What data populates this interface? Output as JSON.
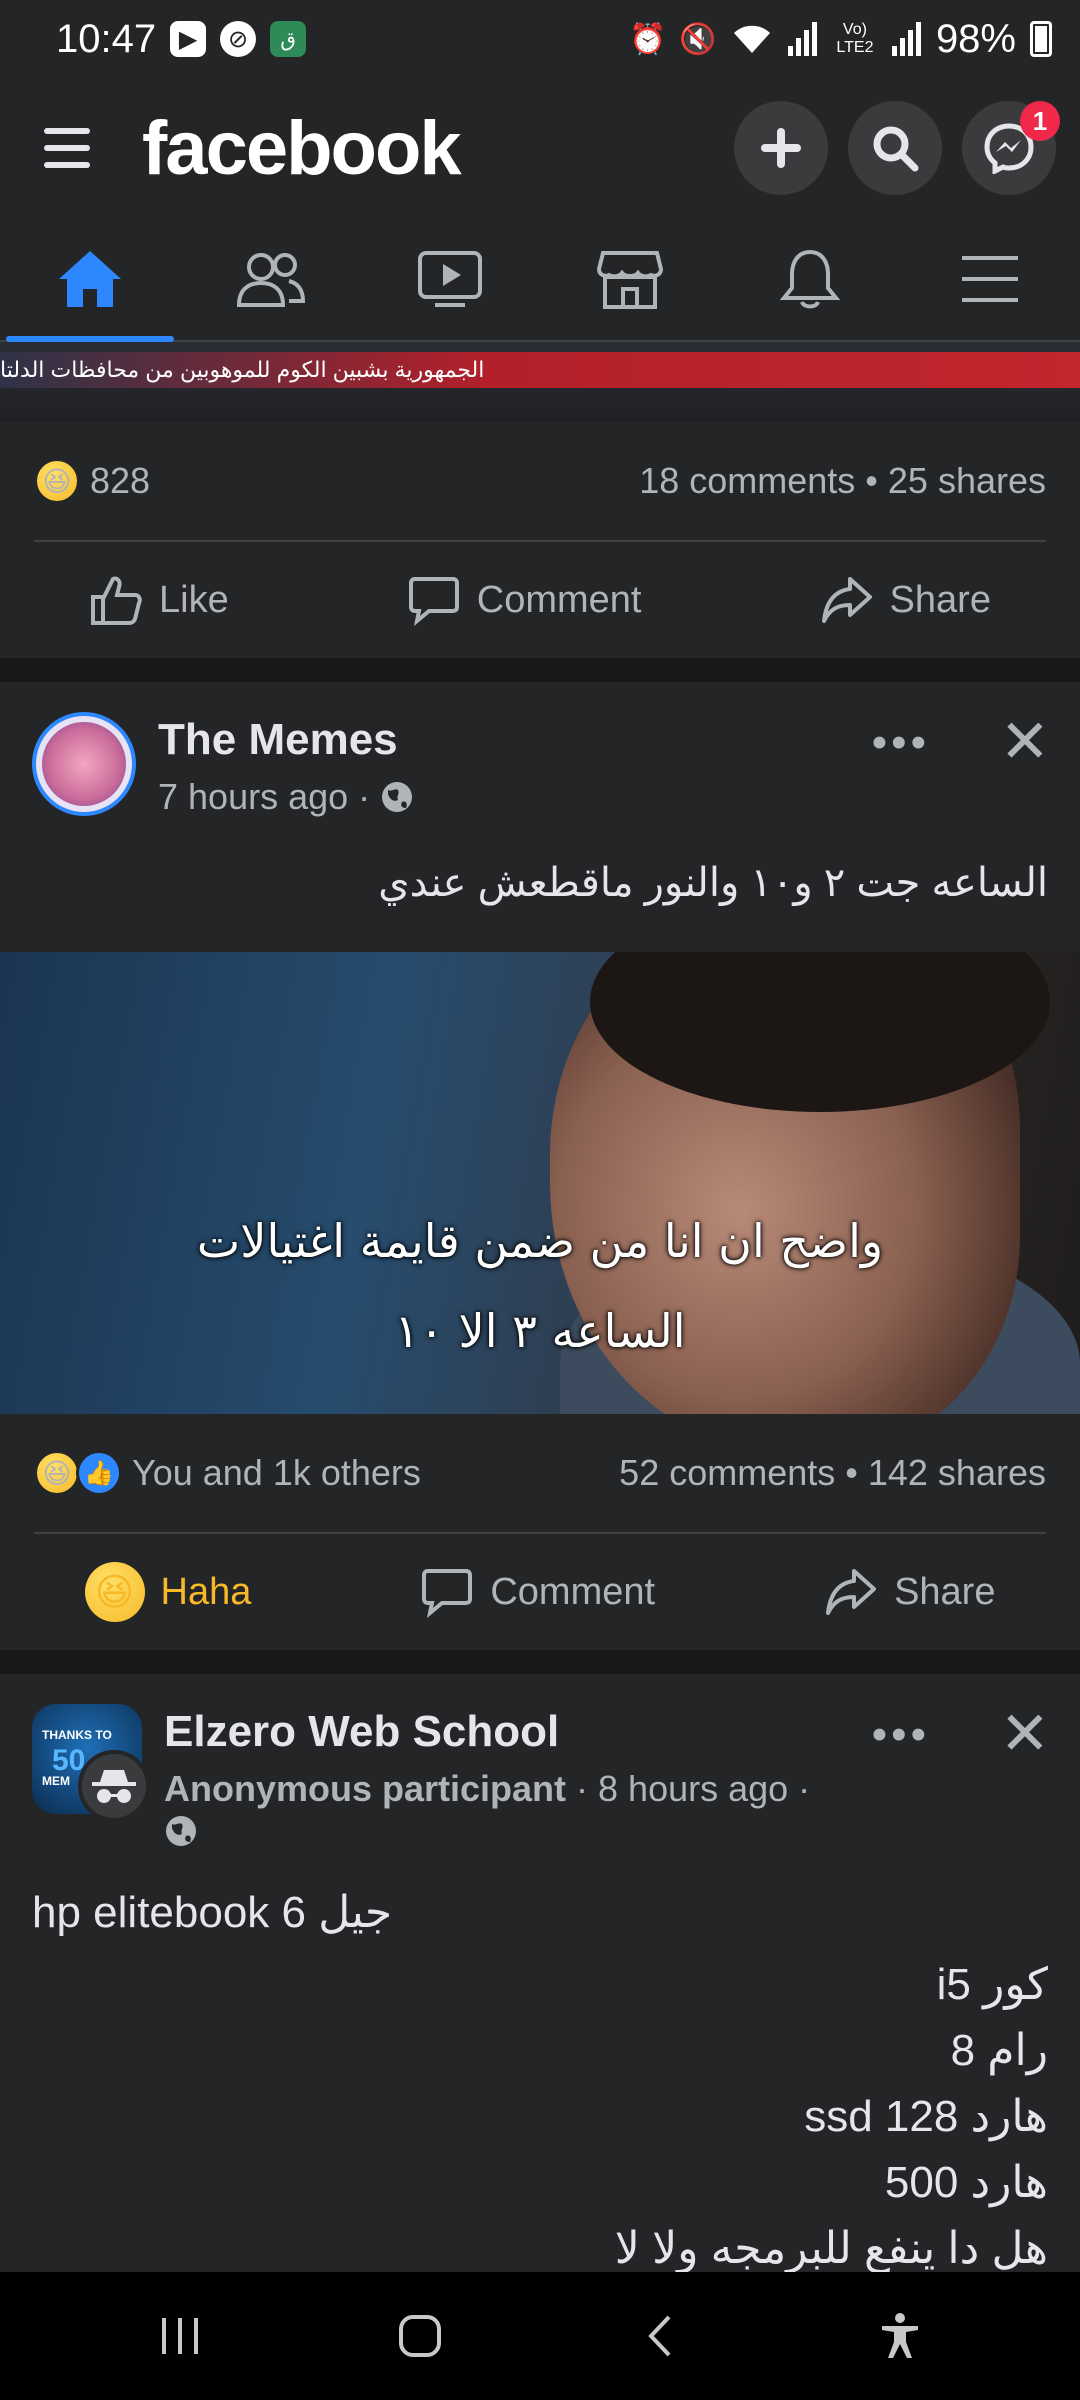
{
  "status_bar": {
    "time": "10:47",
    "network": "Vo) LTE2",
    "battery": "98%"
  },
  "header": {
    "logo": "facebook",
    "messenger_badge": "1",
    "colors": {
      "accent": "#2d88ff",
      "badge": "#f02849",
      "background": "#242526"
    }
  },
  "tabs": [
    {
      "name": "home",
      "icon": "home-icon",
      "active": true
    },
    {
      "name": "friends",
      "icon": "friends-icon",
      "active": false
    },
    {
      "name": "watch",
      "icon": "video-icon",
      "active": false
    },
    {
      "name": "marketplace",
      "icon": "store-icon",
      "active": false
    },
    {
      "name": "notifications",
      "icon": "bell-icon",
      "active": false
    },
    {
      "name": "menu",
      "icon": "menu-icon",
      "active": false
    }
  ],
  "post1": {
    "ticker_text": "الجمهورية بشبين الكوم للموهوبين من محافظات الدلتا",
    "reaction_count": "828",
    "comments_shares": "18 comments • 25 shares",
    "actions": {
      "like": "Like",
      "comment": "Comment",
      "share": "Share"
    }
  },
  "post2": {
    "author": "The Memes",
    "time": "7 hours ago ·",
    "text": "الساعه جت ٢ و١٠ والنور ماقطعش عندي",
    "caption_line1": "واضح ان انا من ضمن قايمة اغتيالات",
    "caption_line2": "الساعه ٣ الا ١٠",
    "reactions_summary": "You and 1k others",
    "comments_shares": "52 comments • 142 shares",
    "actions": {
      "reacted": "Haha",
      "comment": "Comment",
      "share": "Share"
    }
  },
  "post3": {
    "author": "Elzero Web School",
    "participant": "Anonymous participant",
    "time": "· 8 hours ago ·",
    "avatar_text1": "THANKS TO",
    "avatar_text2": "50",
    "avatar_text3": "MEM",
    "line1": "hp elitebook  6 جيل",
    "lines": [
      "كور i5",
      "رام 8",
      "هارد ssd 128",
      "هارد 500",
      "هل دا ينفع للبرمجه ولا لا"
    ]
  }
}
